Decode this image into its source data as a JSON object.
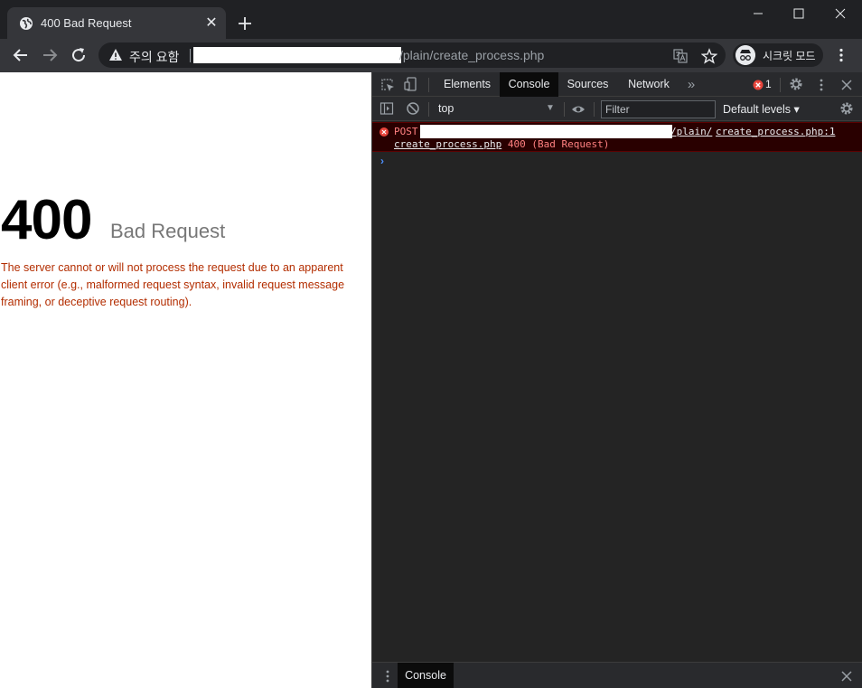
{
  "browser": {
    "tab": {
      "title": "400 Bad Request"
    },
    "omnibox": {
      "security_label": "주의 요함",
      "url_suffix": "/plain/create_process.php"
    },
    "incognito_label": "시크릿 모드"
  },
  "page": {
    "error_code": "400",
    "error_name": "Bad Request",
    "description": "The server cannot or will not process the request due to an apparent client error (e.g., malformed request syntax, invalid request message framing, or deceptive request routing)."
  },
  "devtools": {
    "tabs": [
      "Elements",
      "Console",
      "Sources",
      "Network"
    ],
    "active_tab": "Console",
    "more_tabs": "»",
    "error_count": "1",
    "context": "top",
    "filter_placeholder": "Filter",
    "levels": "Default levels ▾",
    "console_error": {
      "method": "POST",
      "url_tail": "/plain/",
      "source": "create_process.php:1",
      "file": "create_process.php",
      "status": "400 (Bad Request)"
    },
    "prompt": "›",
    "drawer_tab": "Console"
  },
  "colors": {
    "error_text": "#b32d00",
    "console_error_text": "#ff8080",
    "console_error_bg": "#290000",
    "accent_blue": "#4d90fe"
  }
}
